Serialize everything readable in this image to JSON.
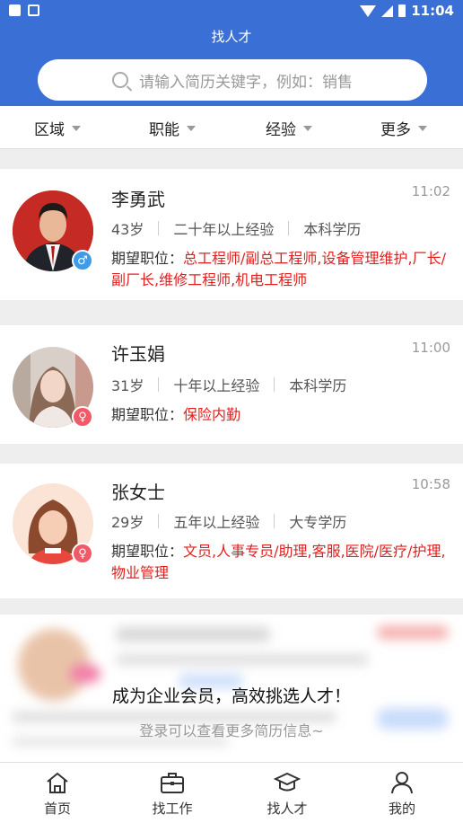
{
  "status_bar": {
    "time": "11:04"
  },
  "header": {
    "title": "找人才"
  },
  "search": {
    "placeholder": "请输入简历关键字，例如：销售"
  },
  "filters": [
    "区域",
    "职能",
    "经验",
    "更多"
  ],
  "candidates": [
    {
      "name": "李勇武",
      "time": "11:02",
      "age": "43岁",
      "experience": "二十年以上经验",
      "education": "本科学历",
      "job_label": "期望职位：",
      "job_value": "总工程师/副总工程师,设备管理维护,厂长/副厂长,维修工程师,机电工程师",
      "gender": "male",
      "gender_symbol": "♂"
    },
    {
      "name": "许玉娟",
      "time": "11:00",
      "age": "31岁",
      "experience": "十年以上经验",
      "education": "本科学历",
      "job_label": "期望职位：",
      "job_value": "保险内勤",
      "gender": "female",
      "gender_symbol": "♀"
    },
    {
      "name": "张女士",
      "time": "10:58",
      "age": "29岁",
      "experience": "五年以上经验",
      "education": "大专学历",
      "job_label": "期望职位：",
      "job_value": "文员,人事专员/助理,客服,医院/医疗/护理,物业管理",
      "gender": "female",
      "gender_symbol": "♀"
    }
  ],
  "promo": {
    "headline": "成为企业会员，高效挑选人才！",
    "subline": "登录可以查看更多简历信息~"
  },
  "bottom_nav": [
    "首页",
    "找工作",
    "找人才",
    "我的"
  ],
  "colors": {
    "primary": "#3a6fd6",
    "highlight": "#e02020",
    "male": "#3e9be8",
    "female": "#f05a68"
  }
}
